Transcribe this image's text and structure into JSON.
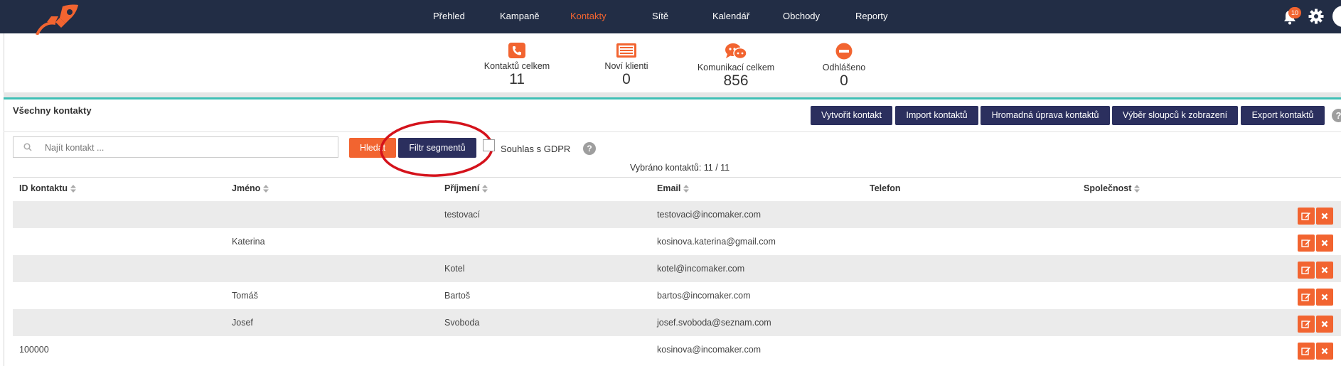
{
  "nav": {
    "items": [
      "Přehled",
      "Kampaně",
      "Kontakty",
      "Sítě",
      "Kalendář",
      "Obchody",
      "Reporty"
    ],
    "active": "Kontakty",
    "notification_count": "10"
  },
  "stats": [
    {
      "label": "Kontaktů celkem",
      "value": "11",
      "icon": "phone-icon"
    },
    {
      "label": "Noví klienti",
      "value": "0",
      "icon": "list-card-icon"
    },
    {
      "label": "Komunikací celkem",
      "value": "856",
      "icon": "chat-bubbles-icon"
    },
    {
      "label": "Odhlášeno",
      "value": "0",
      "icon": "minus-circle-icon"
    }
  ],
  "section": {
    "title": "Všechny kontakty",
    "buttons": [
      "Vytvořit kontakt",
      "Import kontaktů",
      "Hromadná úprava kontaktů",
      "Výběr sloupců k zobrazení",
      "Export kontaktů"
    ]
  },
  "search": {
    "placeholder": "Najít kontakt ...",
    "value": "",
    "search_button": "Hledat",
    "filter_button": "Filtr segmentů",
    "gdpr_label": "Souhlas s GDPR",
    "gdpr_checked": false,
    "help": "?"
  },
  "selected_count": "Vybráno kontaktů: 11 / 11",
  "table": {
    "columns": [
      "ID kontaktu",
      "Jméno",
      "Příjmení",
      "Email",
      "Telefon",
      "Společnost"
    ],
    "rows": [
      {
        "id": "",
        "first_name": "",
        "last_name": "testovací",
        "email": "testovaci@incomaker.com",
        "phone": "",
        "company": ""
      },
      {
        "id": "",
        "first_name": "Katerina",
        "last_name": "",
        "email": "kosinova.katerina@gmail.com",
        "phone": "",
        "company": ""
      },
      {
        "id": "",
        "first_name": "",
        "last_name": "Kotel",
        "email": "kotel@incomaker.com",
        "phone": "",
        "company": ""
      },
      {
        "id": "",
        "first_name": "Tomáš",
        "last_name": "Bartoš",
        "email": "bartos@incomaker.com",
        "phone": "",
        "company": ""
      },
      {
        "id": "",
        "first_name": "Josef",
        "last_name": "Svoboda",
        "email": "josef.svoboda@seznam.com",
        "phone": "",
        "company": ""
      },
      {
        "id": "100000",
        "first_name": "",
        "last_name": "",
        "email": "kosinova@incomaker.com",
        "phone": "",
        "company": ""
      }
    ]
  },
  "colors": {
    "navbar": "#222d45",
    "accent_orange": "#f26430",
    "button_navy": "#2b2f5e",
    "teal_line": "#3fbfb5",
    "annotation_red": "#d4121b"
  }
}
